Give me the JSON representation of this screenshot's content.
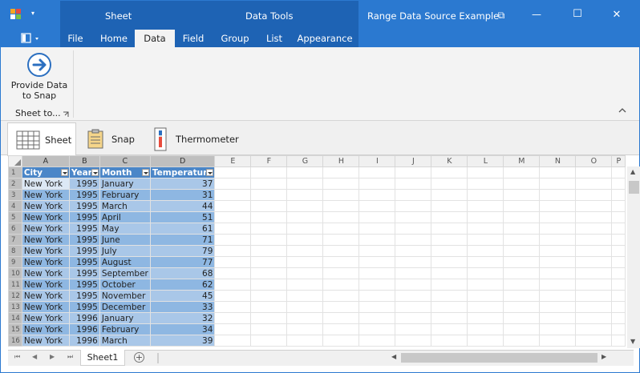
{
  "window": {
    "title": "Range Data Source Example",
    "context_group_left": "Sheet",
    "context_group_right": "Data Tools",
    "minimize_label": "—",
    "maximize_label": "☐",
    "close_label": "✕",
    "restore_label": "⧉"
  },
  "ribbon": {
    "tabs": [
      {
        "label": "File"
      },
      {
        "label": "Home"
      },
      {
        "label": "Data"
      },
      {
        "label": "Field"
      },
      {
        "label": "Group"
      },
      {
        "label": "List"
      },
      {
        "label": "Appearance"
      }
    ],
    "active_tab": "Data",
    "group_label": "Sheet to...",
    "button_label_line1": "Provide Data",
    "button_label_line2": "to Snap"
  },
  "view_tabs": [
    {
      "label": "Sheet",
      "icon": "sheet-icon",
      "active": true
    },
    {
      "label": "Snap",
      "icon": "snap-icon",
      "active": false
    },
    {
      "label": "Thermometer",
      "icon": "thermometer-icon",
      "active": false
    }
  ],
  "grid": {
    "column_headers": [
      "A",
      "B",
      "C",
      "D",
      "E",
      "F",
      "G",
      "H",
      "I",
      "J",
      "K",
      "L",
      "M",
      "N",
      "O",
      "P"
    ],
    "table_headers": [
      "City",
      "Year",
      "Month",
      "Temperature"
    ],
    "rows": [
      {
        "n": "2",
        "city": "New York",
        "year": "1995",
        "month": "January",
        "temp": "37"
      },
      {
        "n": "3",
        "city": "New York",
        "year": "1995",
        "month": "February",
        "temp": "31"
      },
      {
        "n": "4",
        "city": "New York",
        "year": "1995",
        "month": "March",
        "temp": "44"
      },
      {
        "n": "5",
        "city": "New York",
        "year": "1995",
        "month": "April",
        "temp": "51"
      },
      {
        "n": "6",
        "city": "New York",
        "year": "1995",
        "month": "May",
        "temp": "61"
      },
      {
        "n": "7",
        "city": "New York",
        "year": "1995",
        "month": "June",
        "temp": "71"
      },
      {
        "n": "8",
        "city": "New York",
        "year": "1995",
        "month": "July",
        "temp": "79"
      },
      {
        "n": "9",
        "city": "New York",
        "year": "1995",
        "month": "August",
        "temp": "77"
      },
      {
        "n": "10",
        "city": "New York",
        "year": "1995",
        "month": "September",
        "temp": "68"
      },
      {
        "n": "11",
        "city": "New York",
        "year": "1995",
        "month": "October",
        "temp": "62"
      },
      {
        "n": "12",
        "city": "New York",
        "year": "1995",
        "month": "November",
        "temp": "45"
      },
      {
        "n": "13",
        "city": "New York",
        "year": "1995",
        "month": "December",
        "temp": "33"
      },
      {
        "n": "14",
        "city": "New York",
        "year": "1996",
        "month": "January",
        "temp": "32"
      },
      {
        "n": "15",
        "city": "New York",
        "year": "1996",
        "month": "February",
        "temp": "34"
      },
      {
        "n": "16",
        "city": "New York",
        "year": "1996",
        "month": "March",
        "temp": "39"
      }
    ]
  },
  "sheet_tabs": [
    {
      "label": "Sheet1"
    }
  ],
  "add_sheet_label": "+",
  "colors": {
    "title_bar": "#2b79d0",
    "context_band": "#1e63b4",
    "table_header": "#4a86c8",
    "row_light": "#a9c7e8",
    "row_dark": "#8eb7e2"
  }
}
